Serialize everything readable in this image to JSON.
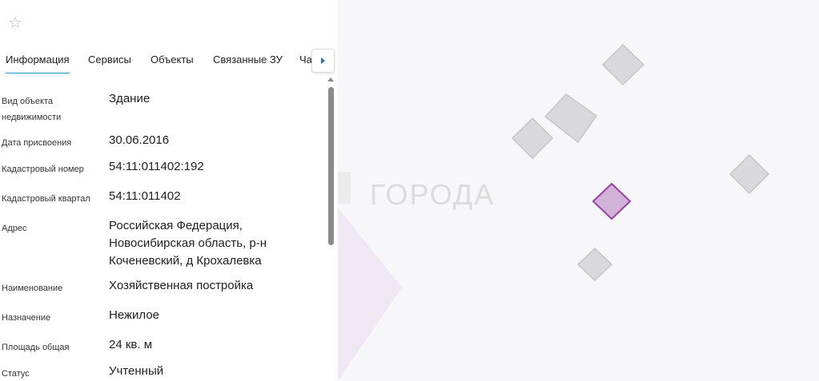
{
  "panel": {
    "favorite_icon": "star-outline-icon",
    "tabs": [
      {
        "label": "Информация",
        "active": true
      },
      {
        "label": "Сервисы",
        "active": false
      },
      {
        "label": "Объекты",
        "active": false
      },
      {
        "label": "Связанные ЗУ",
        "active": false
      },
      {
        "label": "Ча",
        "active": false
      }
    ],
    "tab_scroll_icon": "chevron-right-icon",
    "accent_color": "#2196c9",
    "fields": [
      {
        "label": "Вид объекта недвижимости",
        "value": "Здание"
      },
      {
        "label": "Дата присвоения",
        "value": "30.06.2016"
      },
      {
        "label": "Кадастровый номер",
        "value": "54:11:011402:192"
      },
      {
        "label": "Кадастровый квартал",
        "value": "54:11:011402"
      },
      {
        "label": "Адрес",
        "value": "Российская Федерация, Новосибирская область, р-н Коченевский, д Крохалевка"
      },
      {
        "label": "Наименование",
        "value": "Хозяйственная постройка"
      },
      {
        "label": "Назначение",
        "value": "Нежилое"
      },
      {
        "label": "Площадь общая",
        "value": "24 кв. м"
      },
      {
        "label": "Статус",
        "value": "Учтенный"
      }
    ]
  },
  "map": {
    "watermark_text": "ГОРОДА",
    "selected_color": "#9b3fa6",
    "building_color": "#d9d9db"
  }
}
